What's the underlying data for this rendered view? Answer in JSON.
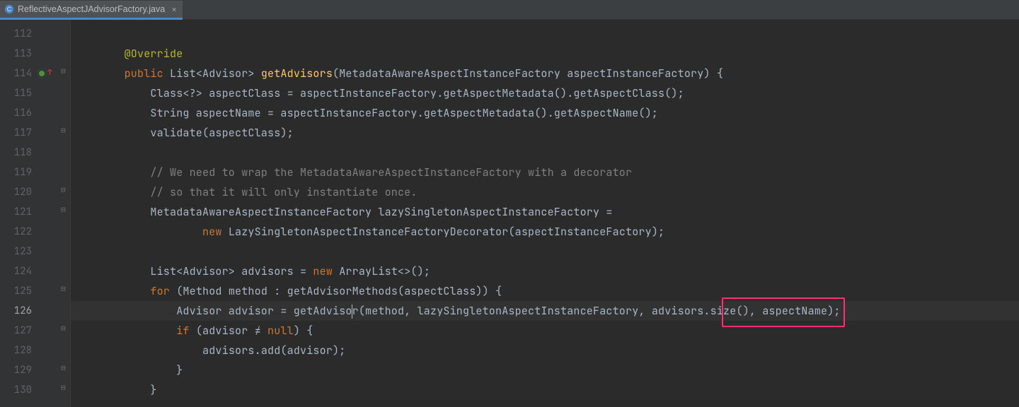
{
  "tab": {
    "title": "ReflectiveAspectJAdvisorFactory.java",
    "close_glyph": "×"
  },
  "gutter": {
    "start": 112,
    "end": 130
  },
  "code": {
    "l112": "",
    "l113": {
      "ind": "        ",
      "ann": "@Override"
    },
    "l114": {
      "ind": "        ",
      "a": "public ",
      "b": "List<Advisor> ",
      "c": "getAdvisors",
      "d": "(MetadataAwareAspectInstanceFactory aspectInstanceFactory) {"
    },
    "l115": {
      "ind": "            ",
      "a": "Class<?> aspectClass = aspectInstanceFactory.getAspectMetadata().getAspectClass();"
    },
    "l116": {
      "ind": "            ",
      "a": "String aspectName = aspectInstanceFactory.getAspectMetadata().getAspectName();"
    },
    "l117": {
      "ind": "            ",
      "a": "validate(aspectClass);"
    },
    "l118": "",
    "l119": {
      "ind": "            ",
      "c": "// We need to wrap the MetadataAwareAspectInstanceFactory with a decorator"
    },
    "l120": {
      "ind": "            ",
      "c": "// so that it will only instantiate once."
    },
    "l121": {
      "ind": "            ",
      "a": "MetadataAwareAspectInstanceFactory lazySingletonAspectInstanceFactory ="
    },
    "l122": {
      "ind": "                    ",
      "a": "new ",
      "b": "LazySingletonAspectInstanceFactoryDecorator(aspectInstanceFactory);"
    },
    "l123": "",
    "l124": {
      "ind": "            ",
      "a": "List<Advisor> advisors = ",
      "b": "new ",
      "c": "ArrayList<>();"
    },
    "l125": {
      "ind": "            ",
      "a": "for ",
      "b": "(Method method : getAdvisorMethods(aspectClass)) {"
    },
    "l126": {
      "ind": "                ",
      "a": "Advisor advisor = getAdviso",
      "b": "r(method, lazySingletonAspectInstanceFactory, ",
      "c": "advisors.size()",
      "d": ", aspectName);"
    },
    "l127": {
      "ind": "                ",
      "a": "if ",
      "b": "(advisor ≠ ",
      "c": "null",
      "d": ") {"
    },
    "l128": {
      "ind": "                    ",
      "a": "advisors.add(advisor);"
    },
    "l129": {
      "ind": "                ",
      "a": "}"
    },
    "l130": {
      "ind": "            ",
      "a": "}"
    }
  },
  "fold_glyphs": {
    "minus": "⊟",
    "end": "⊟"
  },
  "colors": {
    "highlight_box": "#ff2d75",
    "tab_underline": "#4a88c7"
  }
}
